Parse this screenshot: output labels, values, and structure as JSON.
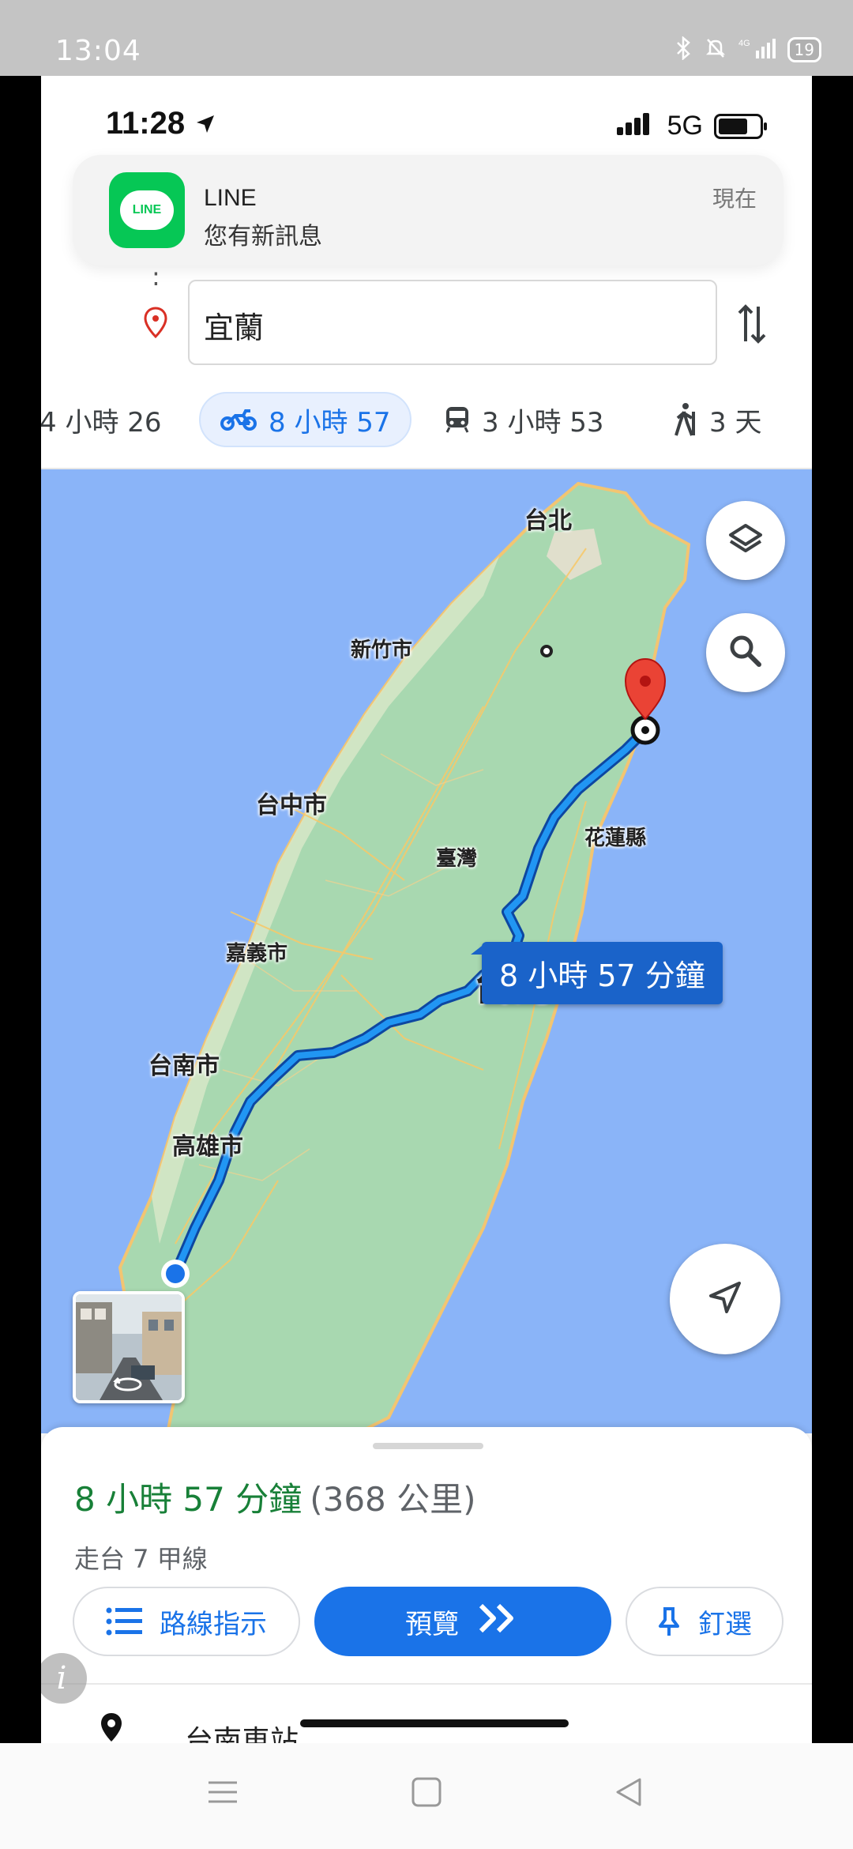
{
  "outer_status": {
    "time": "13:04",
    "battery": "19",
    "network": "4G"
  },
  "ios_status": {
    "time": "11:28",
    "network": "5G"
  },
  "notification": {
    "app": "LINE",
    "logo_text": "LINE",
    "message": "您有新訊息",
    "time": "現在"
  },
  "directions": {
    "destination": "宜蘭",
    "route_dots": ":"
  },
  "travel_modes": [
    {
      "name": "drive",
      "icon": "car-icon",
      "label": "4 小時 26",
      "selected": false
    },
    {
      "name": "motorcycle",
      "icon": "motorcycle-icon",
      "label": "8 小時 57",
      "selected": true
    },
    {
      "name": "transit",
      "icon": "train-icon",
      "label": "3 小時 53",
      "selected": false
    },
    {
      "name": "walk",
      "icon": "walk-icon",
      "label": "3 天",
      "selected": false
    }
  ],
  "map": {
    "labels": {
      "taipei": "台北",
      "hsinchu": "新竹市",
      "taichung": "台中市",
      "hualien": "花蓮縣",
      "taiwan_small": "臺灣",
      "chiayi": "嘉義市",
      "taiwan": "台灣",
      "tainan": "台南市",
      "kaohsiung": "高雄市"
    },
    "route_badge": "8 小時 57 分鐘",
    "colors": {
      "sea": "#8ab4f8",
      "land": "#a8d8b0",
      "route": "#1a73e8",
      "pin": "#ea4335"
    }
  },
  "sheet": {
    "duration": "8 小時 57 分鐘",
    "distance": "(368 公里)",
    "via": "走台 7 甲線",
    "buttons": {
      "steps": "路線指示",
      "preview": "預覽",
      "pin": "釘選"
    },
    "origin": "台南車站"
  }
}
